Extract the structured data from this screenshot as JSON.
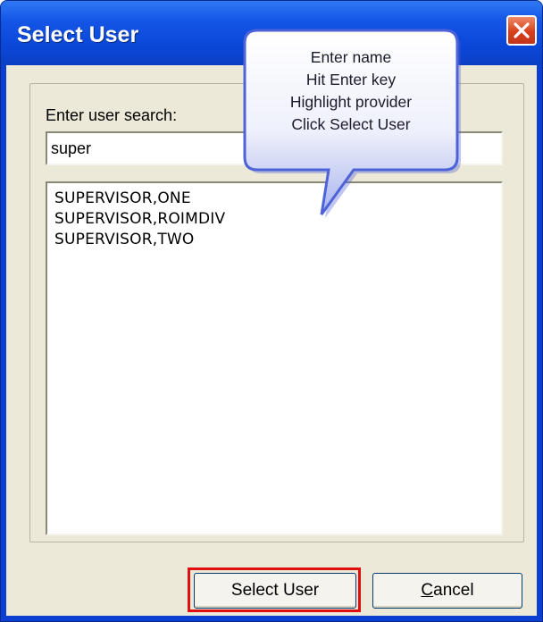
{
  "window": {
    "title": "Select User",
    "close_icon": "close-icon"
  },
  "search": {
    "label": "Enter user search:",
    "value": "super"
  },
  "results": {
    "items": [
      "SUPERVISOR,ONE",
      "SUPERVISOR,ROIMDIV",
      "SUPERVISOR,TWO"
    ]
  },
  "buttons": {
    "select_label": "Select User",
    "cancel_label": "Cancel"
  },
  "callout": {
    "lines": [
      "Enter name",
      "Hit Enter key",
      "Highlight provider",
      "Click Select User"
    ]
  },
  "colors": {
    "titlebar": "#0a47d8",
    "close": "#d8401c",
    "highlight": "#e01010",
    "callout": "#5a6fe0"
  }
}
